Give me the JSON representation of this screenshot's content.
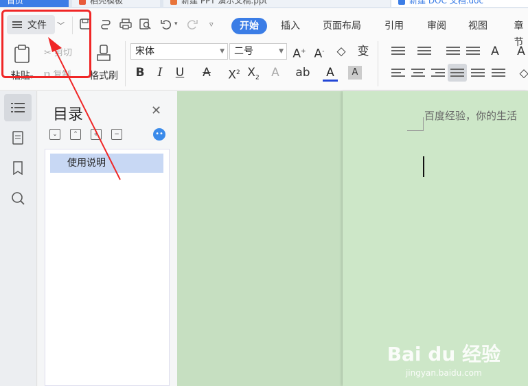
{
  "tabs": [
    {
      "label": "首页"
    },
    {
      "label": "稻壳模板"
    },
    {
      "label": "新建 PPT 演示文稿.ppt"
    },
    {
      "label": "新建 DOC 文档.doc"
    }
  ],
  "ribbon": {
    "file_label": "文件",
    "menu": [
      "开始",
      "插入",
      "页面布局",
      "引用",
      "审阅",
      "视图",
      "章节"
    ],
    "paste_label": "粘贴",
    "cut_label": "剪切",
    "copy_label": "复制",
    "format_painter_label": "格式刷",
    "font_name": "宋体",
    "font_size": "二号"
  },
  "toc": {
    "title": "目录",
    "items": [
      "使用说明"
    ]
  },
  "document": {
    "text": "百度经验，你的生活"
  },
  "watermark": {
    "logo": "Bai du 经验",
    "url": "jingyan.baidu.com"
  },
  "colors": {
    "accent": "#3b7de6",
    "annotation": "#f02626",
    "page_bg": "#cde7c8"
  }
}
